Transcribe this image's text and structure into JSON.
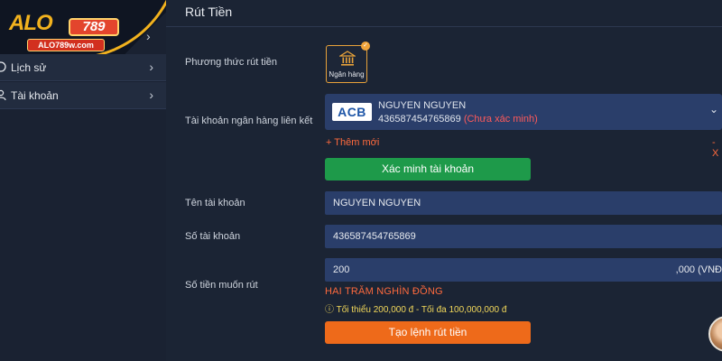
{
  "logo": {
    "text_main": "ALO",
    "text_box": "789",
    "text_sub": "ALO789w.com"
  },
  "sidebar": {
    "items": [
      {
        "label": "Lịch sử"
      },
      {
        "label": "Tài khoản"
      }
    ]
  },
  "page": {
    "title": "Rút Tiền"
  },
  "form": {
    "method_label": "Phương thức rút tiền",
    "method_option": "Ngân hàng",
    "bank_account_label": "Tài khoản ngân hàng liên kết",
    "bank": {
      "logo": "ACB",
      "holder": "NGUYEN NGUYEN",
      "number": "436587454765869",
      "status": "(Chưa xác minh)"
    },
    "add_new": "+ Thêm mới",
    "remove": "- X",
    "verify_button": "Xác minh tài khoản",
    "account_name_label": "Tên tài khoản",
    "account_name_value": "NGUYEN NGUYEN",
    "account_number_label": "Số tài khoản",
    "account_number_value": "436587454765869",
    "amount_label": "Số tiền muốn rút",
    "amount_value": "200",
    "amount_suffix": ",000 (VNĐ",
    "amount_in_words": "HAI TRĂM NGHÌN ĐỒNG",
    "limits": "ⓘ Tối thiểu 200,000 đ - Tối đa 100,000,000 đ",
    "submit_button": "Tạo lệnh rút tiền"
  },
  "colors": {
    "background": "#1b2434",
    "field": "#2a3e6a",
    "verify": "#1e9a4a",
    "submit": "#ee6a1a",
    "accent": "#ff6a3d",
    "warning": "#f2d85a"
  },
  "icons": [
    "bank-icon",
    "history-icon",
    "user-icon",
    "chevron-right-icon",
    "check-icon",
    "chevron-down-icon"
  ]
}
